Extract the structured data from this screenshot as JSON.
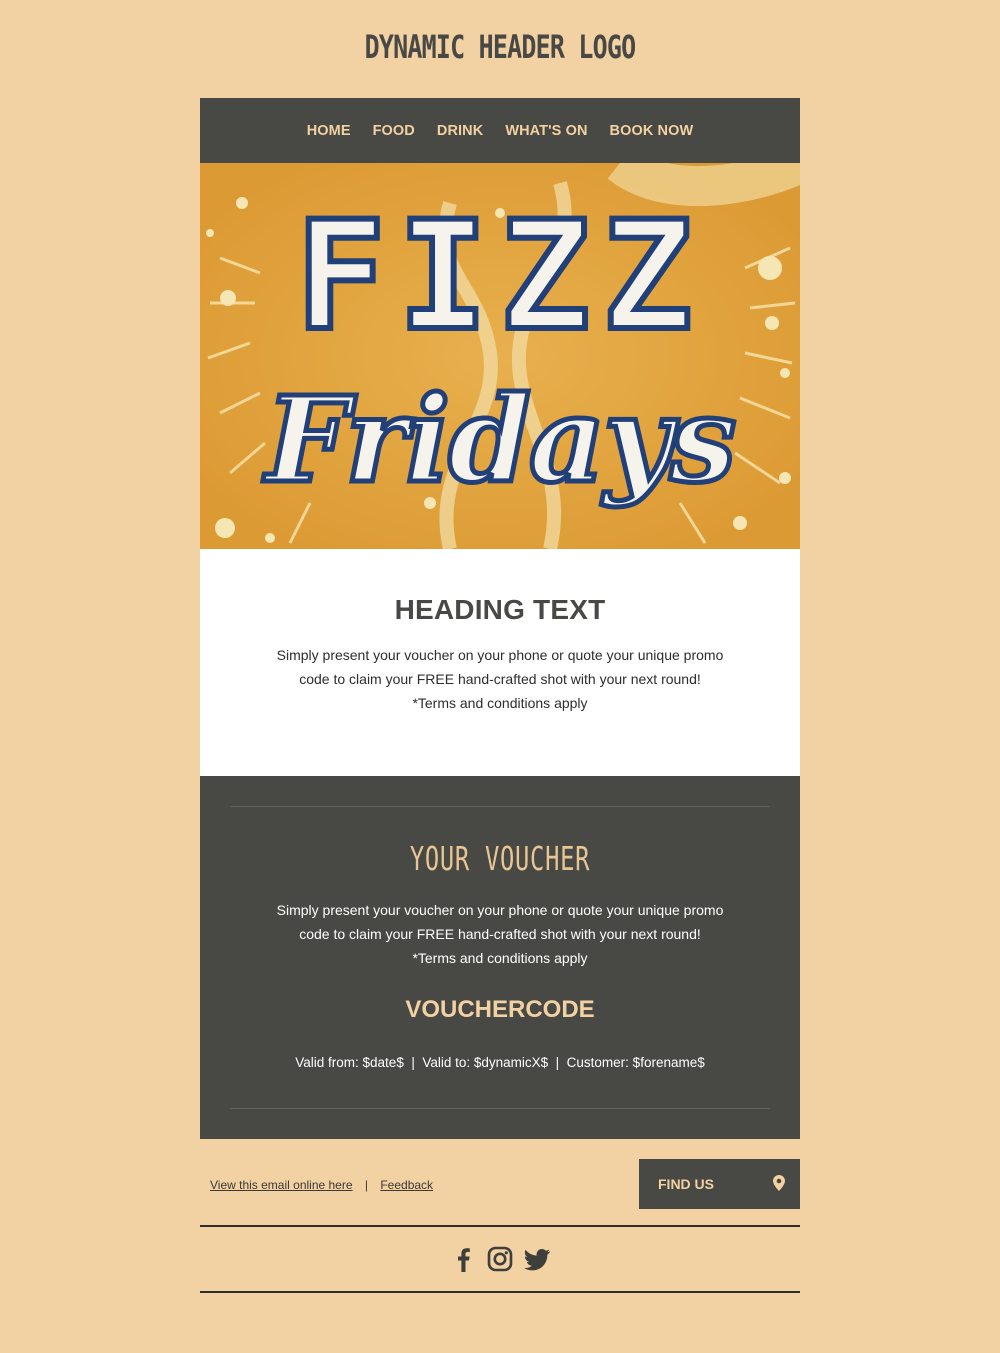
{
  "header": {
    "logo_text": "DYNAMIC HEADER LOGO"
  },
  "nav": {
    "items": [
      {
        "label": "HOME"
      },
      {
        "label": "FOOD"
      },
      {
        "label": "DRINK"
      },
      {
        "label": "WHAT'S ON"
      },
      {
        "label": "BOOK NOW"
      }
    ]
  },
  "hero": {
    "line1": "FIZZ",
    "line2": "Fridays"
  },
  "intro": {
    "heading": "HEADING TEXT",
    "line1": "Simply present your voucher on your phone or quote your unique promo",
    "line2": "code to claim your FREE hand-crafted shot with your next round!",
    "line3": "*Terms and conditions apply"
  },
  "voucher": {
    "title": "YOUR VOUCHER",
    "line1": "Simply present your voucher on your phone or quote your unique promo",
    "line2": "code to claim your FREE hand-crafted shot with your next round!",
    "line3": "*Terms and conditions apply",
    "code": "VOUCHERCODE",
    "meta": "Valid from: $date$  |  Valid to: $dynamicX$  |  Customer: $forename$"
  },
  "footer": {
    "view_online": "View this email online here",
    "separator": "|",
    "feedback": "Feedback",
    "find_us": "FIND US"
  },
  "social": {
    "icons": [
      "facebook-icon",
      "instagram-icon",
      "twitter-icon"
    ]
  },
  "colors": {
    "background": "#f2d1a2",
    "dark": "#484844",
    "accent": "#f2d1a2",
    "hero_orange": "#e0a13c",
    "hero_letter_outline": "#213f78"
  }
}
